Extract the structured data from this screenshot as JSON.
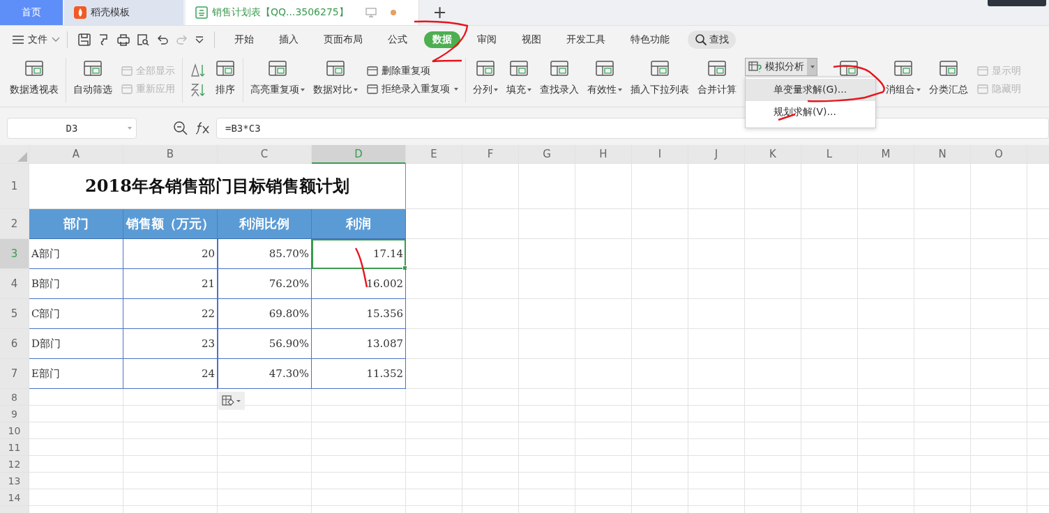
{
  "tabs": [
    {
      "label": "首页",
      "kind": "home",
      "selected": false
    },
    {
      "label": "稻壳模板",
      "kind": "docer",
      "selected": false
    },
    {
      "label": "销售计划表【QQ...3506275】",
      "kind": "sheet",
      "selected": true,
      "unsaved": true
    }
  ],
  "new_tab": "+",
  "menu": {
    "file": "文件",
    "tabs": [
      {
        "label": "开始",
        "selected": false
      },
      {
        "label": "插入",
        "selected": false
      },
      {
        "label": "页面布局",
        "selected": false
      },
      {
        "label": "公式",
        "selected": false
      },
      {
        "label": "数据",
        "selected": true
      },
      {
        "label": "审阅",
        "selected": false
      },
      {
        "label": "视图",
        "selected": false
      },
      {
        "label": "开发工具",
        "selected": false
      },
      {
        "label": "特色功能",
        "selected": false
      }
    ],
    "search": "查找"
  },
  "ribbon": [
    {
      "kind": "big",
      "label": "数据透视表",
      "caret": false
    },
    {
      "kind": "sep"
    },
    {
      "kind": "big",
      "label": "自动筛选",
      "caret": false
    },
    {
      "kind": "pair",
      "items": [
        {
          "label": "全部显示",
          "caret": false,
          "disabled": true
        },
        {
          "label": "重新应用",
          "caret": false,
          "disabled": true
        }
      ]
    },
    {
      "kind": "sep"
    },
    {
      "kind": "sort"
    },
    {
      "kind": "big",
      "label": "排序",
      "caret": false
    },
    {
      "kind": "sep"
    },
    {
      "kind": "big",
      "label": "高亮重复项",
      "caret": true
    },
    {
      "kind": "big",
      "label": "数据对比",
      "caret": true
    },
    {
      "kind": "pair",
      "items": [
        {
          "label": "删除重复项",
          "caret": false,
          "disabled": false
        },
        {
          "label": "拒绝录入重复项",
          "caret": true,
          "disabled": false
        }
      ]
    },
    {
      "kind": "sep"
    },
    {
      "kind": "big",
      "label": "分列",
      "caret": true
    },
    {
      "kind": "big",
      "label": "填充",
      "caret": true
    },
    {
      "kind": "big",
      "label": "查找录入",
      "caret": false
    },
    {
      "kind": "big",
      "label": "有效性",
      "caret": true
    },
    {
      "kind": "big",
      "label": "插入下拉列表",
      "caret": false
    },
    {
      "kind": "big",
      "label": "合并计算",
      "caret": false
    },
    {
      "kind": "dropdown",
      "label": "模拟分析",
      "open": true,
      "items": [
        {
          "label": "单变量求解(G)...",
          "selected": true
        },
        {
          "label": "规划求解(V)...",
          "selected": false
        }
      ]
    },
    {
      "kind": "big"
    },
    {
      "kind": "big",
      "label": "消组合",
      "caret": true
    },
    {
      "kind": "big",
      "label": "分类汇总",
      "caret": false
    },
    {
      "kind": "pair",
      "items": [
        {
          "label": "显示明",
          "caret": false,
          "disabled": true
        },
        {
          "label": "隐藏明",
          "caret": false,
          "disabled": true
        }
      ]
    }
  ],
  "formula_bar": {
    "name_box": "D3",
    "formula": "=B3*C3"
  },
  "columns": [
    {
      "label": "A",
      "selected": false
    },
    {
      "label": "B",
      "selected": false
    },
    {
      "label": "C",
      "selected": false
    },
    {
      "label": "D",
      "selected": true
    },
    {
      "label": "E",
      "selected": false
    },
    {
      "label": "F",
      "selected": false
    },
    {
      "label": "G",
      "selected": false
    },
    {
      "label": "H",
      "selected": false
    },
    {
      "label": "I",
      "selected": false
    },
    {
      "label": "J",
      "selected": false
    },
    {
      "label": "K",
      "selected": false
    },
    {
      "label": "L",
      "selected": false
    },
    {
      "label": "M",
      "selected": false
    },
    {
      "label": "N",
      "selected": false
    },
    {
      "label": "O",
      "selected": false
    }
  ],
  "title_row": "1",
  "header_row": "2",
  "title": "2018年各销售部门目标销售额计划",
  "headers": [
    "部门",
    "销售额（万元）",
    "利润比例",
    "利润"
  ],
  "rows": [
    {
      "number": "3",
      "selected": true,
      "cells": [
        "A部门",
        "20",
        "85.70%",
        "17.14"
      ]
    },
    {
      "number": "4",
      "selected": false,
      "cells": [
        "B部门",
        "21",
        "76.20%",
        "16.002"
      ]
    },
    {
      "number": "5",
      "selected": false,
      "cells": [
        "C部门",
        "22",
        "69.80%",
        "15.356"
      ]
    },
    {
      "number": "6",
      "selected": false,
      "cells": [
        "D部门",
        "23",
        "56.90%",
        "13.087"
      ]
    },
    {
      "number": "7",
      "selected": false,
      "cells": [
        "E部门",
        "24",
        "47.30%",
        "11.352"
      ]
    }
  ],
  "empty_rows": [
    "8",
    "9",
    "10",
    "11",
    "12",
    "13",
    "14"
  ]
}
